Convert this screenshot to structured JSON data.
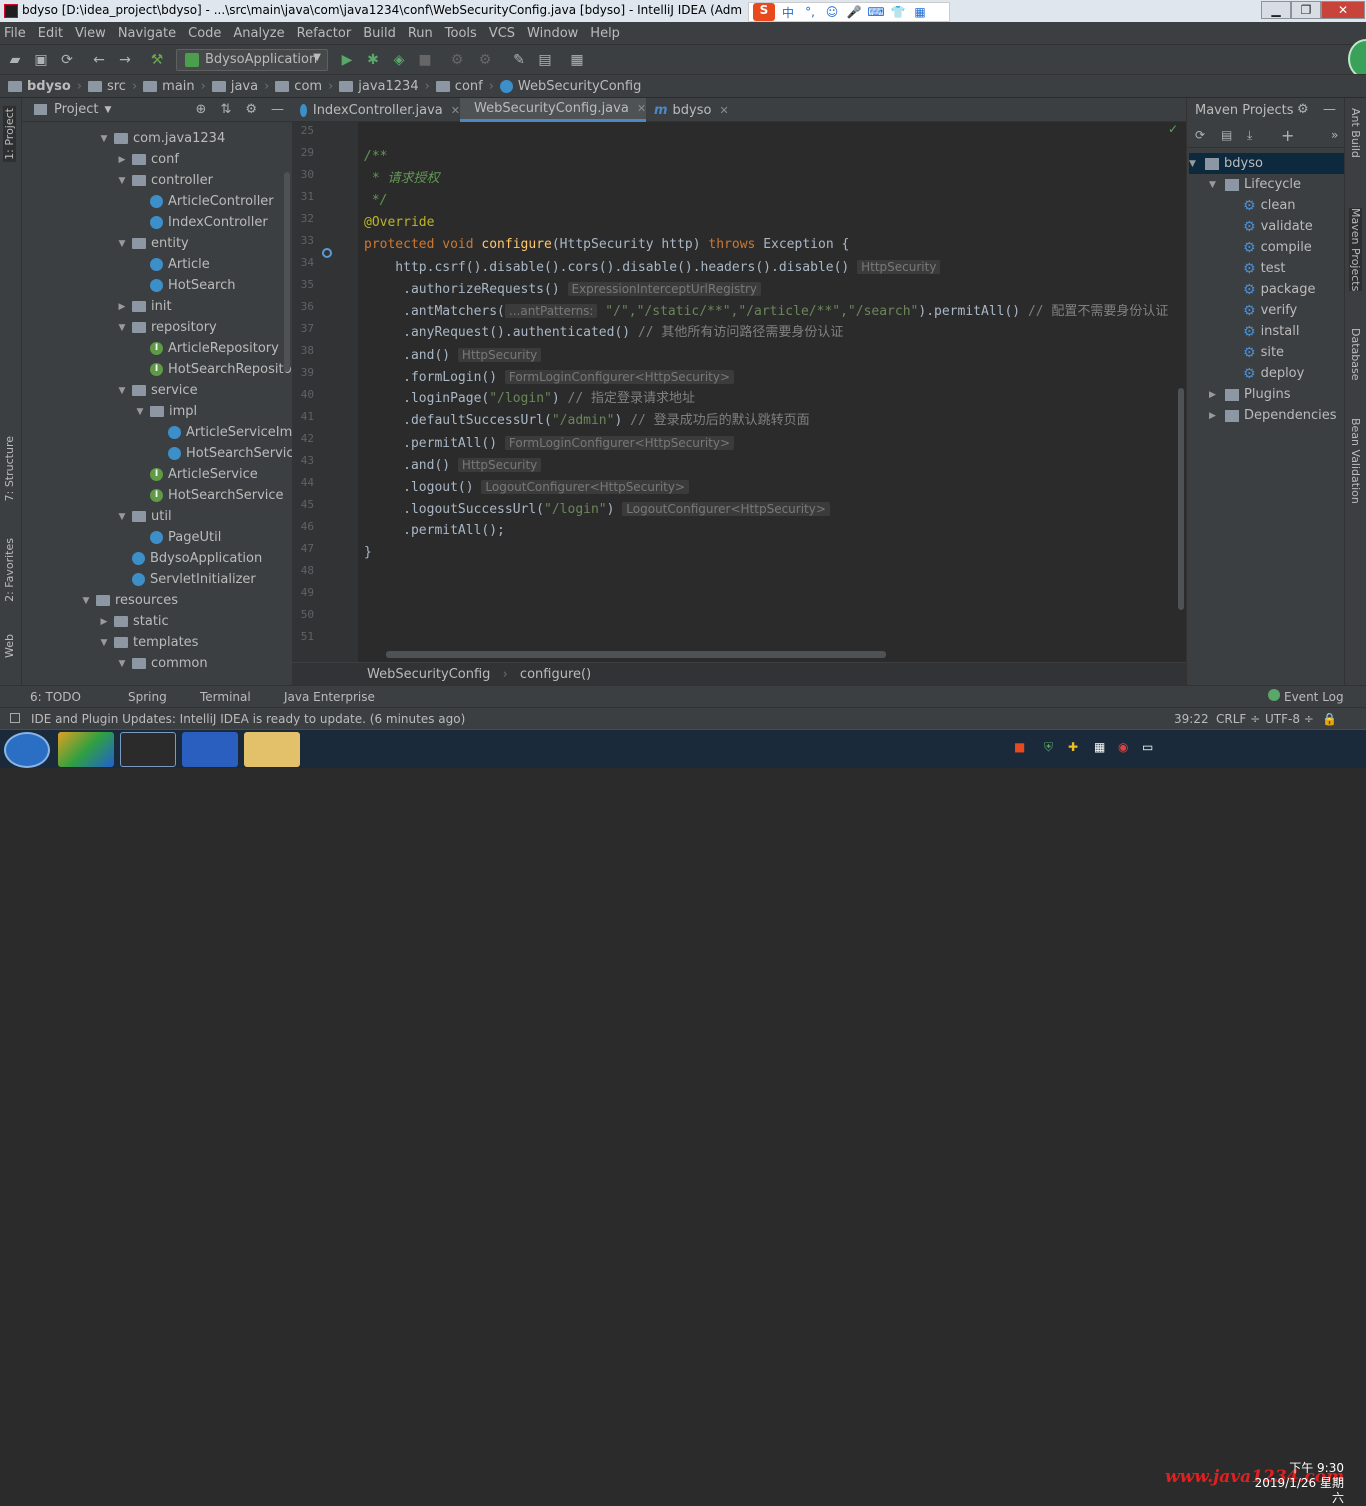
{
  "window": {
    "title": "bdyso [D:\\idea_project\\bdyso] - ...\\src\\main\\java\\com\\java1234\\conf\\WebSecurityConfig.java [bdyso] - IntelliJ IDEA (Administ"
  },
  "ime": {
    "items": [
      "中",
      "°,",
      "☺",
      "🎤",
      "⌨",
      "👕",
      "▦"
    ]
  },
  "menu": [
    "File",
    "Edit",
    "View",
    "Navigate",
    "Code",
    "Analyze",
    "Refactor",
    "Build",
    "Run",
    "Tools",
    "VCS",
    "Window",
    "Help"
  ],
  "toolbar": {
    "run_config": "BdysoApplication"
  },
  "breadcrumb": [
    "bdyso",
    "src",
    "main",
    "java",
    "com",
    "java1234",
    "conf",
    "WebSecurityConfig"
  ],
  "left_stripe": {
    "project": "1: Project",
    "structure": "7: Structure",
    "favorites": "2: Favorites",
    "web": "Web"
  },
  "right_stripe": {
    "ant": "Ant Build",
    "maven": "Maven Projects",
    "database": "Database",
    "bean": "Bean Validation"
  },
  "project_panel": {
    "title": "Project",
    "tree": [
      {
        "label": "com.java1234",
        "type": "folder",
        "depth": 1,
        "expanded": true
      },
      {
        "label": "conf",
        "type": "folder",
        "depth": 2,
        "expanded": false
      },
      {
        "label": "controller",
        "type": "folder",
        "depth": 2,
        "expanded": true
      },
      {
        "label": "ArticleController",
        "type": "class",
        "depth": 3
      },
      {
        "label": "IndexController",
        "type": "class",
        "depth": 3
      },
      {
        "label": "entity",
        "type": "folder",
        "depth": 2,
        "expanded": true
      },
      {
        "label": "Article",
        "type": "class",
        "depth": 3
      },
      {
        "label": "HotSearch",
        "type": "class",
        "depth": 3
      },
      {
        "label": "init",
        "type": "folder",
        "depth": 2,
        "expanded": false
      },
      {
        "label": "repository",
        "type": "folder",
        "depth": 2,
        "expanded": true
      },
      {
        "label": "ArticleRepository",
        "type": "interface",
        "depth": 3
      },
      {
        "label": "HotSearchRepository",
        "type": "interface",
        "depth": 3
      },
      {
        "label": "service",
        "type": "folder",
        "depth": 2,
        "expanded": true
      },
      {
        "label": "impl",
        "type": "folder",
        "depth": 3,
        "expanded": true
      },
      {
        "label": "ArticleServiceImpl",
        "type": "class",
        "depth": 4
      },
      {
        "label": "HotSearchServiceI",
        "type": "class",
        "depth": 4
      },
      {
        "label": "ArticleService",
        "type": "interface",
        "depth": 3
      },
      {
        "label": "HotSearchService",
        "type": "interface",
        "depth": 3
      },
      {
        "label": "util",
        "type": "folder",
        "depth": 2,
        "expanded": true
      },
      {
        "label": "PageUtil",
        "type": "class",
        "depth": 3
      },
      {
        "label": "BdysoApplication",
        "type": "boot",
        "depth": 2
      },
      {
        "label": "ServletInitializer",
        "type": "class",
        "depth": 2
      },
      {
        "label": "resources",
        "type": "folder",
        "depth": 0,
        "expanded": true
      },
      {
        "label": "static",
        "type": "folder",
        "depth": 1
      },
      {
        "label": "templates",
        "type": "folder",
        "depth": 1,
        "expanded": true
      },
      {
        "label": "common",
        "type": "folder",
        "depth": 2,
        "expanded": true
      }
    ]
  },
  "editor": {
    "tabs": [
      {
        "label": "IndexController.java",
        "active": false
      },
      {
        "label": "WebSecurityConfig.java",
        "active": true
      },
      {
        "label": "bdyso",
        "active": false
      }
    ],
    "lines": [
      {
        "n": "25"
      },
      {
        "n": "29"
      },
      {
        "n": "30"
      },
      {
        "n": "31"
      },
      {
        "n": "32"
      },
      {
        "n": "33"
      },
      {
        "n": "34"
      },
      {
        "n": "35"
      },
      {
        "n": "36"
      },
      {
        "n": "37"
      },
      {
        "n": "38"
      },
      {
        "n": "39"
      },
      {
        "n": "40"
      },
      {
        "n": "41"
      },
      {
        "n": "42"
      },
      {
        "n": "43"
      },
      {
        "n": "44"
      },
      {
        "n": "45"
      },
      {
        "n": "46"
      },
      {
        "n": "47"
      },
      {
        "n": "48"
      },
      {
        "n": "49"
      },
      {
        "n": "50"
      },
      {
        "n": "51"
      }
    ],
    "code": {
      "l29": "/**",
      "l30": " * 请求授权",
      "l31": " */",
      "l32": "@Override",
      "l33a": "protected void ",
      "l33b": "configure",
      "l33c": "(HttpSecurity http) ",
      "l33d": "throws ",
      "l33e": "Exception {",
      "l34": "    http.csrf().disable().cors().disable().headers().disable()",
      "l34h": "HttpSecurity",
      "l35": "     .authorizeRequests()",
      "l35h": "ExpressionInterceptUrlRegistry",
      "l36a": "     .antMatchers(",
      "l36h": "...antPatterns:",
      "l36s": "\"/\",\"/static/**\",\"/article/**\",\"/search\"",
      "l36b": ").permitAll() ",
      "l36c": "// 配置不需要身份认证",
      "l37a": "     .anyRequest().authenticated() ",
      "l37c": "// 其他所有访问路径需要身份认证",
      "l38": "     .and()",
      "l38h": "HttpSecurity",
      "l39": "     .formLogin()",
      "l39h": "FormLoginConfigurer<HttpSecurity>",
      "l40a": "     .loginPage(",
      "l40s": "\"/login\"",
      "l40b": ") ",
      "l40c": "// 指定登录请求地址",
      "l41a": "     .defaultSuccessUrl(",
      "l41s": "\"/admin\"",
      "l41b": ") ",
      "l41c": "// 登录成功后的默认跳转页面",
      "l42": "     .permitAll()",
      "l42h": "FormLoginConfigurer<HttpSecurity>",
      "l43": "     .and()",
      "l43h": "HttpSecurity",
      "l44": "     .logout()",
      "l44h": "LogoutConfigurer<HttpSecurity>",
      "l45a": "     .logoutSuccessUrl(",
      "l45s": "\"/login\"",
      "l45b": ")",
      "l45h": "LogoutConfigurer<HttpSecurity>",
      "l46": "     .permitAll();",
      "l47": "}"
    },
    "breadcrumb": [
      "WebSecurityConfig",
      "configure()"
    ]
  },
  "maven": {
    "title": "Maven Projects",
    "project": "bdyso",
    "lifecycle": "Lifecycle",
    "goals": [
      "clean",
      "validate",
      "compile",
      "test",
      "package",
      "verify",
      "install",
      "site",
      "deploy"
    ],
    "plugins": "Plugins",
    "dependencies": "Dependencies"
  },
  "bottom_tabs": [
    "6: TODO",
    "Spring",
    "Terminal",
    "Java Enterprise"
  ],
  "event_log": "Event Log",
  "status": {
    "message": "IDE and Plugin Updates: IntelliJ IDEA is ready to update. (6 minutes ago)",
    "position": "39:22",
    "line_sep": "CRLF ÷",
    "encoding": "UTF-8 ÷"
  },
  "taskbar": {
    "watermark": "www.java1234.com",
    "time": "下午 9:30",
    "date": "2019/1/26 星期六"
  }
}
